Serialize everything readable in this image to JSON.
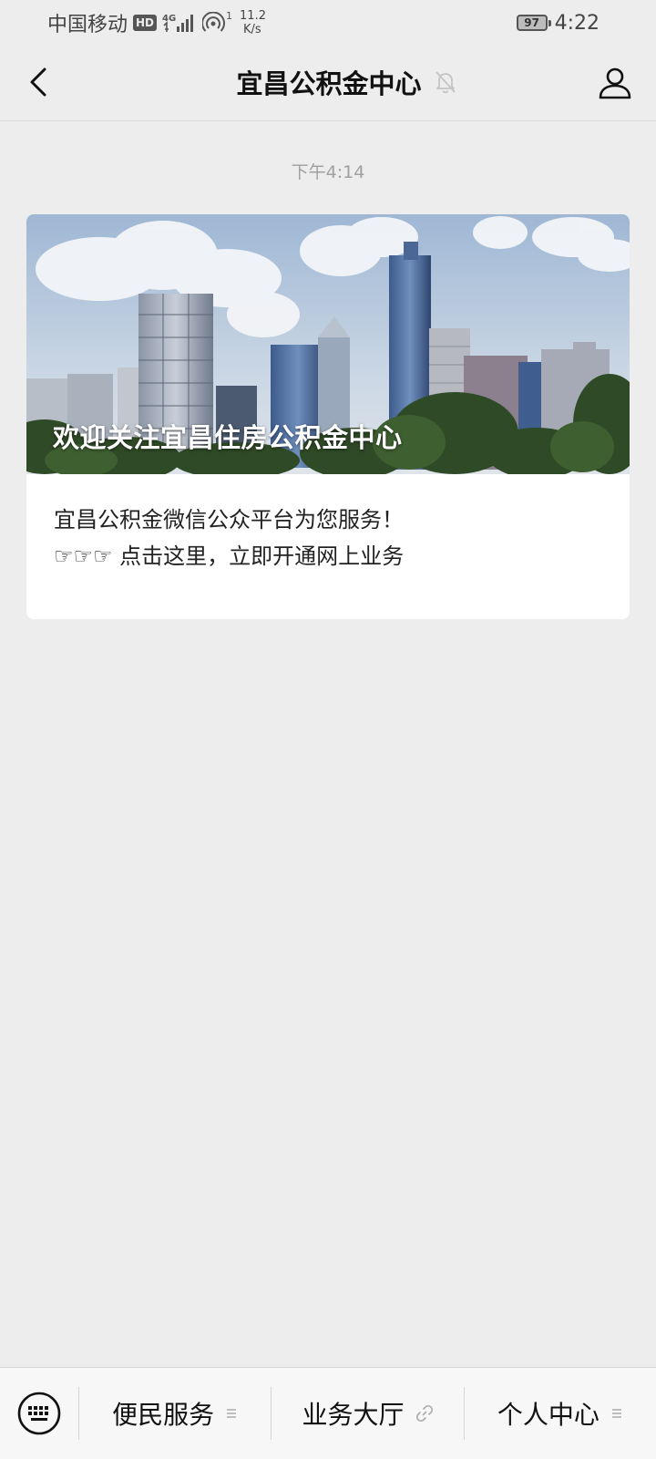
{
  "status_bar": {
    "carrier": "中国移动",
    "hd_badge": "HD",
    "network_type": "4G",
    "net_speed_value": "11.2",
    "net_speed_unit": "K/s",
    "hotspot_count": "1",
    "battery_level": "97",
    "time": "4:22"
  },
  "nav": {
    "title": "宜昌公积金中心",
    "back_icon": "chevron-left-icon",
    "mute_icon": "bell-off-icon",
    "profile_icon": "person-icon"
  },
  "chat": {
    "timestamp": "下午4:14",
    "article": {
      "banner_title": "欢迎关注宜昌住房公积金中心",
      "line1": "宜昌公积金微信公众平台为您服务！",
      "line2": "☞☞☞ 点击这里，立即开通网上业务"
    }
  },
  "bottom_menu": {
    "keyboard_icon": "keyboard-icon",
    "items": [
      {
        "label": "便民服务",
        "suffix_icon": "submenu-lines-icon"
      },
      {
        "label": "业务大厅",
        "suffix_icon": "link-icon"
      },
      {
        "label": "个人中心",
        "suffix_icon": "submenu-lines-icon"
      }
    ]
  },
  "colors": {
    "background": "#ededed",
    "card": "#ffffff",
    "timestamp": "#a0a0a0",
    "menu_background": "#f7f7f7"
  }
}
